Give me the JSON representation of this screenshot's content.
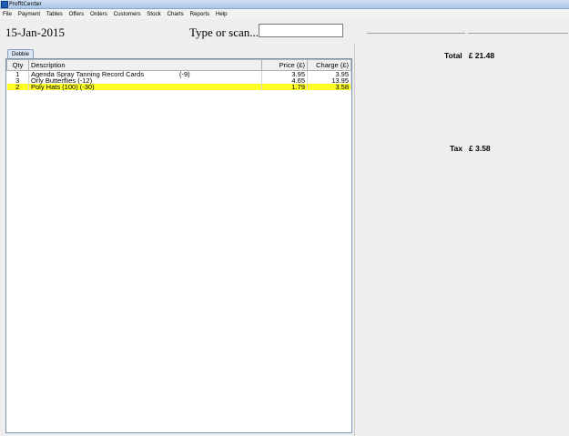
{
  "window": {
    "title": "ProfitCenter"
  },
  "menu": [
    "File",
    "Payment",
    "Tables",
    "Offers",
    "Orders",
    "Customers",
    "Stock",
    "Charts",
    "Reports",
    "Help"
  ],
  "header": {
    "date": "15-Jan-2015",
    "scan_label": "Type or scan...",
    "scan_value": ""
  },
  "tab": {
    "label": "Debbie"
  },
  "table": {
    "columns": {
      "qty": "Qty",
      "description": "Description",
      "price": "Price (£)",
      "charge": "Charge (£)"
    },
    "rows": [
      {
        "qty": "1",
        "description": "Agenda Spray Tanning Record Cards",
        "code": "(-9)",
        "price": "3.95",
        "charge": "3.95"
      },
      {
        "qty": "3",
        "description": "Orly Butterflies (-12)",
        "code": "",
        "price": "4.65",
        "charge": "13.95"
      },
      {
        "qty": "2",
        "description": "Poly Hats (100) (-30)",
        "code": "",
        "price": "1.79",
        "charge": "3.58"
      }
    ]
  },
  "summary": {
    "total_label": "Total",
    "total_value": "£ 21.48",
    "tax_label": "Tax",
    "tax_value": "£ 3.58"
  },
  "colors": {
    "selected_row": "#ffff26",
    "tab_bg": "#dbe6f4"
  }
}
